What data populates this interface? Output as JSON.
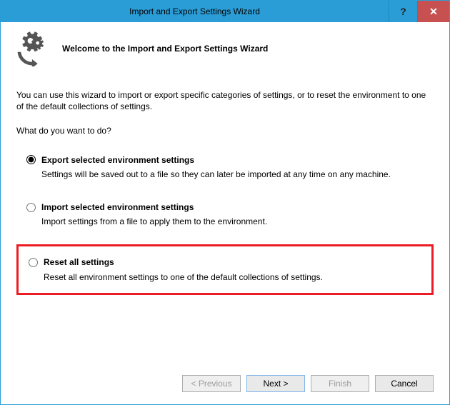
{
  "window": {
    "title": "Import and Export Settings Wizard"
  },
  "header": {
    "welcome": "Welcome to the Import and Export Settings Wizard"
  },
  "content": {
    "intro": "You can use this wizard to import or export specific categories of settings, or to reset the environment to one of the default collections of settings.",
    "question": "What do you want to do?"
  },
  "options": {
    "export": {
      "label": "Export selected environment settings",
      "desc": "Settings will be saved out to a file so they can later be imported at any time on any machine."
    },
    "import": {
      "label": "Import selected environment settings",
      "desc": "Import settings from a file to apply them to the environment."
    },
    "reset": {
      "label": "Reset all settings",
      "desc": "Reset all environment settings to one of the default collections of settings."
    }
  },
  "footer": {
    "previous": "< Previous",
    "next": "Next >",
    "finish": "Finish",
    "cancel": "Cancel"
  }
}
